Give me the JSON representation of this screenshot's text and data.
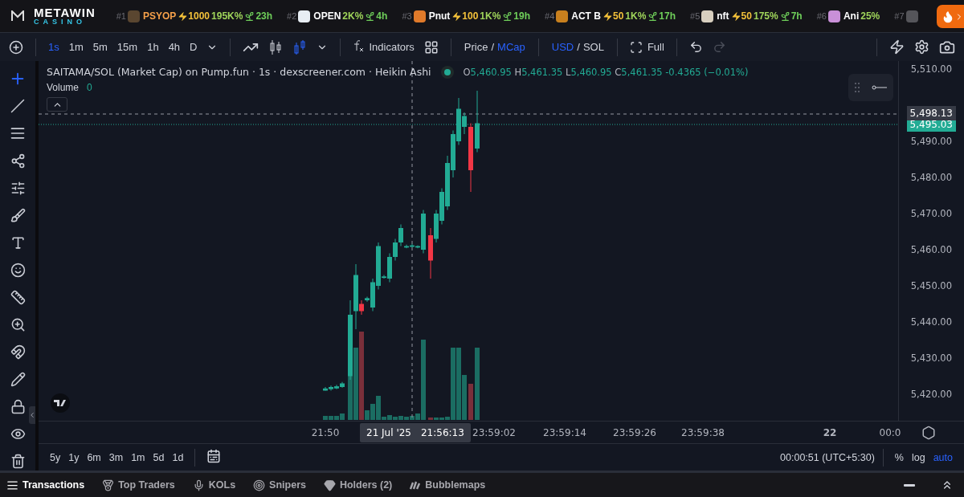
{
  "ticker": {
    "logo": {
      "top": "METAWIN",
      "bottom": "CASINO"
    },
    "items": [
      {
        "rank": "#1",
        "name": "PSYOP",
        "boost": "1000",
        "change": "195K%",
        "age": "23h",
        "highlight": true,
        "color": "#5a4630"
      },
      {
        "rank": "#2",
        "name": "OPEN",
        "change": "2K%",
        "age": "4h",
        "highlight": false,
        "color": "#e8eef4"
      },
      {
        "rank": "#3",
        "name": "Pnut",
        "boost": "100",
        "change": "1K%",
        "age": "19h",
        "highlight": false,
        "color": "#e07a2a"
      },
      {
        "rank": "#4",
        "name": "ACT B",
        "boost": "50",
        "change": "1K%",
        "age": "17h",
        "highlight": false,
        "color": "#c8801e"
      },
      {
        "rank": "#5",
        "name": "nft",
        "boost": "50",
        "change": "175%",
        "age": "7h",
        "highlight": false,
        "color": "#d8cfbf"
      },
      {
        "rank": "#6",
        "name": "Ani",
        "change": "25%",
        "highlight": false,
        "color": "#c990d8"
      },
      {
        "rank": "#7",
        "color": "#55555a"
      }
    ]
  },
  "toolbar": {
    "intervals": [
      {
        "label": "1s",
        "selected": true
      },
      {
        "label": "1m",
        "selected": false
      },
      {
        "label": "5m",
        "selected": false
      },
      {
        "label": "15m",
        "selected": false
      },
      {
        "label": "1h",
        "selected": false
      },
      {
        "label": "4h",
        "selected": false
      },
      {
        "label": "D",
        "selected": false
      }
    ],
    "chart_types": [
      {
        "kind": "line",
        "selected": false
      },
      {
        "kind": "candles",
        "selected": false
      },
      {
        "kind": "heikin",
        "selected": true
      }
    ],
    "indicators": "Indicators",
    "price_toggle": {
      "separator": "/",
      "options": [
        {
          "label": "Price",
          "selected": false
        },
        {
          "label": "MCap",
          "selected": true
        }
      ]
    },
    "currency_toggle": {
      "separator": "/",
      "options": [
        {
          "label": "USD",
          "selected": true
        },
        {
          "label": "SOL",
          "selected": false
        }
      ]
    },
    "full": "Full",
    "redo_disabled": true
  },
  "legend": {
    "title": "SAITAMA/SOL (Market Cap) on Pump.fun · 1s · dexscreener.com · Heikin Ashi",
    "ohlc": [
      {
        "key": "O",
        "value": "5,460.95"
      },
      {
        "key": "H",
        "value": "5,461.35"
      },
      {
        "key": "L",
        "value": "5,460.95"
      },
      {
        "key": "C",
        "value": "5,461.35"
      }
    ],
    "change": "-0.4365 (−0.01%)",
    "volume_label": "Volume",
    "volume_value": "0"
  },
  "price_axis": {
    "ticks": [
      "5,510.00",
      "5,490.00",
      "5,480.00",
      "5,470.00",
      "5,460.00",
      "5,450.00",
      "5,440.00",
      "5,430.00",
      "5,420.00"
    ],
    "crosshair_label": "5,498.13",
    "last_price": "5,495.03"
  },
  "time_axis": {
    "ticks": [
      {
        "label": "21:50",
        "bold": false
      },
      {
        "label": "23:59:02",
        "bold": false
      },
      {
        "label": "23:59:14",
        "bold": false
      },
      {
        "label": "23:59:26",
        "bold": false
      },
      {
        "label": "23:59:38",
        "bold": false
      },
      {
        "label": "22",
        "bold": true
      },
      {
        "label": "00:0",
        "bold": false
      }
    ],
    "crosshair_date": "21 Jul '25",
    "crosshair_time": "21:56:13"
  },
  "ranges": [
    "5y",
    "1y",
    "6m",
    "3m",
    "1m",
    "5d",
    "1d"
  ],
  "timezone": "00:00:51 (UTC+5:30)",
  "scale_options": [
    {
      "label": "%",
      "selected": false
    },
    {
      "label": "log",
      "selected": false
    },
    {
      "label": "auto",
      "selected": true
    }
  ],
  "tabs": [
    {
      "label": "Transactions",
      "kind": "list",
      "selected": true
    },
    {
      "label": "Top Traders",
      "kind": "medal",
      "selected": false
    },
    {
      "label": "KOLs",
      "kind": "mic",
      "selected": false
    },
    {
      "label": "Snipers",
      "kind": "target",
      "selected": false
    },
    {
      "label": "Holders (2)",
      "kind": "gem",
      "selected": false
    },
    {
      "label": "Bubblemaps",
      "kind": "bars",
      "selected": false
    }
  ]
}
